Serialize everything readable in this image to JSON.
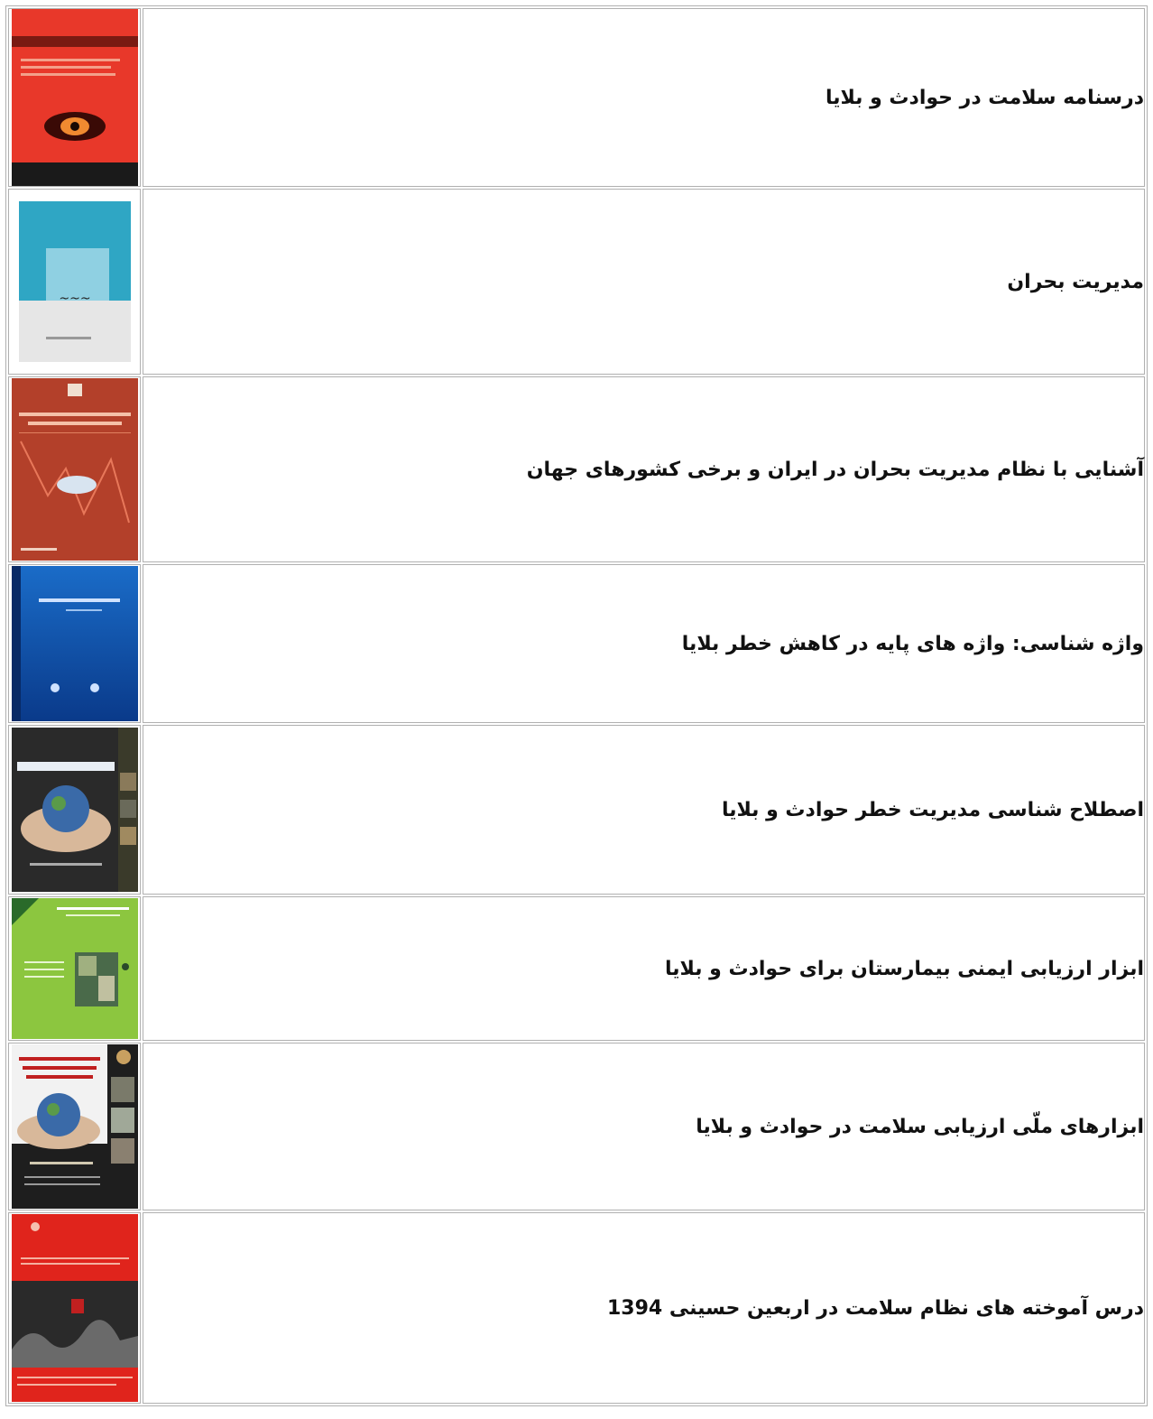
{
  "books": [
    {
      "title": "درسنامه سلامت در حوادث و بلایا",
      "cover_icon": "book-cover-red-eye",
      "colors": [
        "#e8382a",
        "#1a1a1a"
      ]
    },
    {
      "title": "مدیریت بحران",
      "cover_icon": "book-cover-teal-grey",
      "colors": [
        "#2fa6c4",
        "#e6e6e6"
      ]
    },
    {
      "title": "آشنایی با نظام مدیریت بحران در ایران و برخی کشورهای جهان",
      "cover_icon": "book-cover-rust",
      "colors": [
        "#b3402a"
      ]
    },
    {
      "title": "واژه شناسی: واژه های پایه در کاهش خطر بلایا",
      "cover_icon": "book-cover-blue",
      "colors": [
        "#0b4aa3"
      ]
    },
    {
      "title": "اصطلاح شناسی مدیریت خطر حوادث و بلایا",
      "cover_icon": "book-cover-dark-globe",
      "colors": [
        "#2a2a2a"
      ]
    },
    {
      "title": "ابزار ارزیابی ایمنی بیمارستان برای حوادث و بلایا",
      "cover_icon": "book-cover-green",
      "colors": [
        "#8cc63f"
      ]
    },
    {
      "title": "ابزارهای ملّی ارزیابی سلامت در حوادث و بلایا",
      "cover_icon": "book-cover-dark-globe-hands",
      "colors": [
        "#1e1e1e"
      ]
    },
    {
      "title": "درس آموخته های نظام سلامت در اربعین حسینی 1394",
      "cover_icon": "book-cover-red-crowd",
      "colors": [
        "#e0241c"
      ]
    }
  ]
}
